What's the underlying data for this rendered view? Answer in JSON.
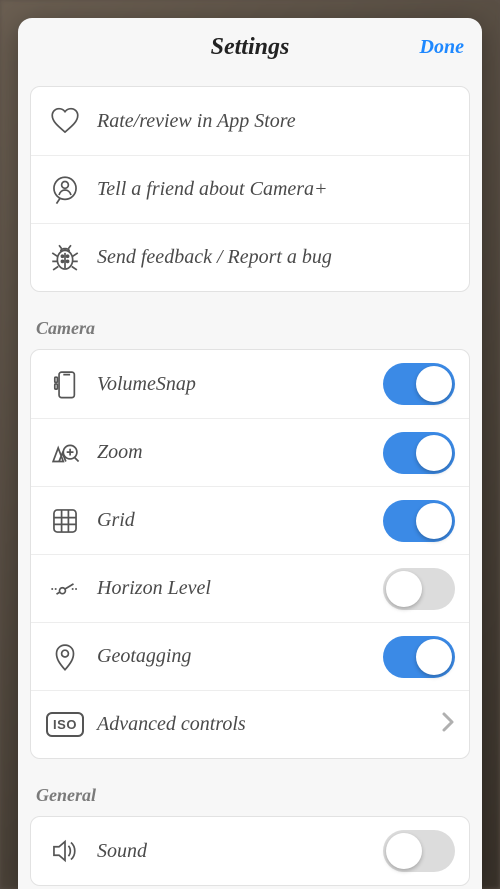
{
  "header": {
    "title": "Settings",
    "done": "Done"
  },
  "about": {
    "rate": {
      "label": "Rate/review in App Store"
    },
    "tell": {
      "label": "Tell a friend about Camera+"
    },
    "feedback": {
      "label": "Send feedback / Report a bug"
    }
  },
  "sections": {
    "camera": {
      "title": "Camera",
      "items": {
        "volumesnap": {
          "label": "VolumeSnap",
          "on": true
        },
        "zoom": {
          "label": "Zoom",
          "on": true
        },
        "grid": {
          "label": "Grid",
          "on": true
        },
        "horizon": {
          "label": "Horizon Level",
          "on": false
        },
        "geotag": {
          "label": "Geotagging",
          "on": true
        },
        "advanced": {
          "label": "Advanced controls",
          "iso_text": "ISO"
        }
      }
    },
    "general": {
      "title": "General",
      "items": {
        "sound": {
          "label": "Sound",
          "on": false
        }
      }
    }
  }
}
